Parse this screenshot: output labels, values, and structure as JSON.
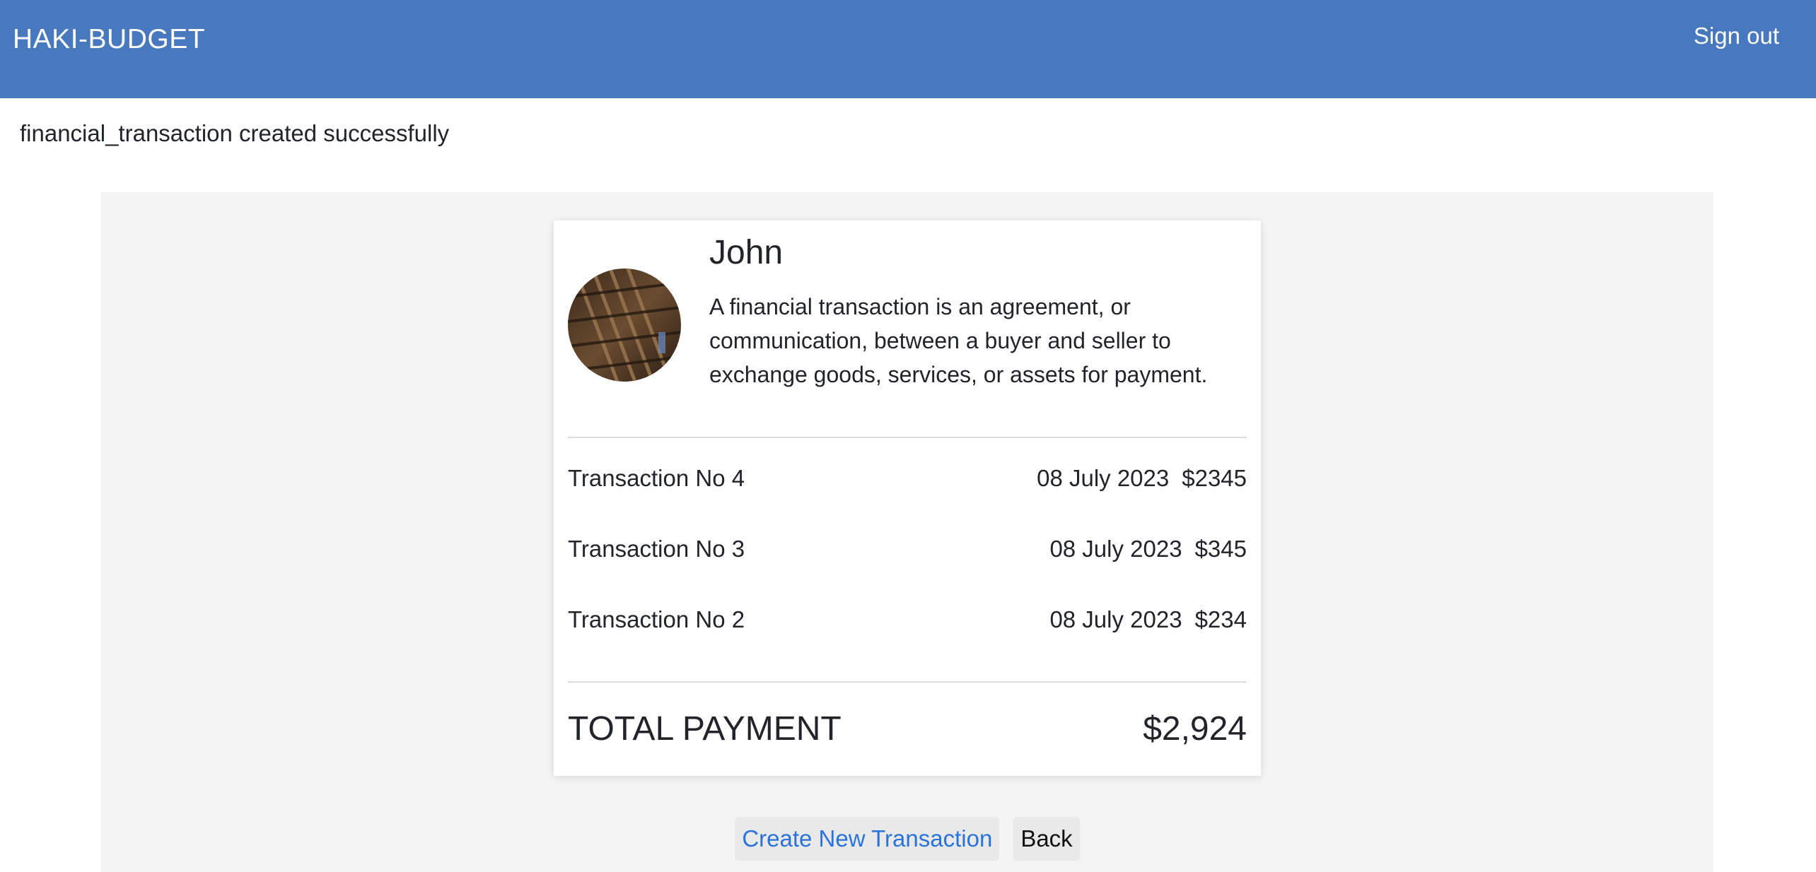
{
  "navbar": {
    "brand": "HAKI-BUDGET",
    "sign_out": "Sign out",
    "background": "#4878be"
  },
  "flash": {
    "message": "financial_transaction created successfully"
  },
  "profile": {
    "name": "John",
    "description": "A financial transaction is an agreement, or communication, between a buyer and seller to exchange goods, services, or assets for payment."
  },
  "transactions": [
    {
      "label": "Transaction No 4",
      "date": "08 July 2023",
      "amount": "$2345"
    },
    {
      "label": "Transaction No 3",
      "date": "08 July 2023",
      "amount": "$345"
    },
    {
      "label": "Transaction No 2",
      "date": "08 July 2023",
      "amount": "$234"
    }
  ],
  "total": {
    "label": "TOTAL PAYMENT",
    "value": "$2,924"
  },
  "actions": {
    "create_label": "Create New Transaction",
    "back_label": "Back",
    "link_color": "#2a73d8"
  }
}
